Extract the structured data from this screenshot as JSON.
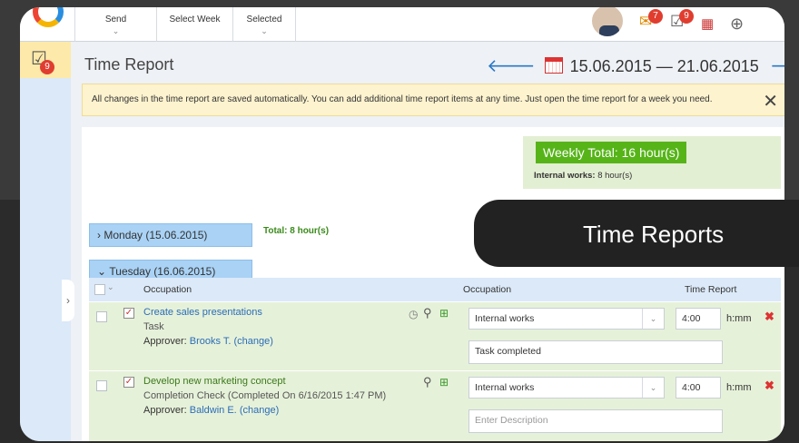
{
  "toolbar": {
    "send_label": "Send",
    "select_week_label": "Select Week",
    "selected_label": "Selected",
    "mail_badge": "7",
    "tasks_badge": "9"
  },
  "sidebar": {
    "reports_badge": "9"
  },
  "page": {
    "title": "Time Report",
    "date_range": "15.06.2015 — 21.06.2015"
  },
  "notice": {
    "text": "All changes in the time report are saved automatically. You can add additional time report items at any time. Just open the time report for a week you need."
  },
  "summary": {
    "weekly_total": "Weekly Total: 16 hour(s)",
    "internal_label": "Internal works:",
    "internal_value": "8 hour(s)"
  },
  "days": {
    "monday": "Monday (15.06.2015)",
    "monday_total": "Total: 8 hour(s)",
    "tuesday": "Tuesday (16.06.2015)"
  },
  "grid": {
    "col_occupation": "Occupation",
    "col_occupation2": "Occupation",
    "col_time": "Time Report",
    "rows": [
      {
        "title": "Create sales presentations",
        "subtitle": "Task",
        "approver_label": "Approver:",
        "approver_name": "Brooks T.",
        "change": "(change)",
        "occupation": "Internal works",
        "time": "4:00",
        "unit": "h:mm",
        "description": "Task completed"
      },
      {
        "title": "Develop new marketing concept",
        "subtitle": "Completion Check (Completed On 6/16/2015 1:47 PM)",
        "approver_label": "Approver:",
        "approver_name": "Baldwin E.",
        "change": "(change)",
        "occupation": "Internal works",
        "time": "4:00",
        "unit": "h:mm",
        "description_placeholder": "Enter Description"
      }
    ]
  },
  "tooltip": {
    "text": "Time Reports"
  }
}
